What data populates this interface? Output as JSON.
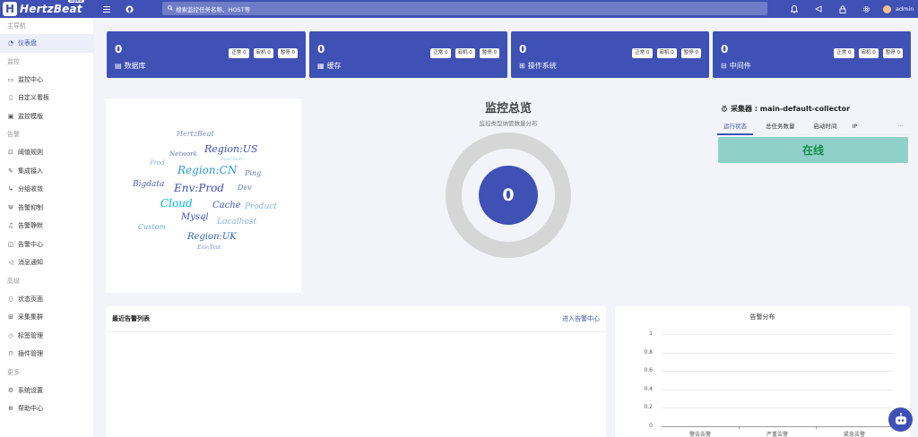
{
  "header": {
    "logo_text": "HertzBeat",
    "logo_mark": "H",
    "logo_badge": "alpha",
    "menu_icon": "menu-icon",
    "github_icon": "github-icon",
    "search_placeholder": "搜索监控任务名称、HOST等",
    "icons": [
      "bell-icon",
      "send-icon",
      "lock-icon",
      "gear-icon"
    ],
    "user_name": "admin"
  },
  "sidebar": {
    "groups": [
      {
        "label": "主导航",
        "items": [
          {
            "label": "仪表盘",
            "icon": "dashboard-icon",
            "active": true
          }
        ]
      },
      {
        "label": "监控",
        "items": [
          {
            "label": "监控中心",
            "icon": "monitor-icon"
          },
          {
            "label": "自定义看板",
            "icon": "board-icon"
          },
          {
            "label": "监控模版",
            "icon": "template-icon"
          }
        ]
      },
      {
        "label": "告警",
        "items": [
          {
            "label": "阈值规则",
            "icon": "rule-icon"
          },
          {
            "label": "集成接入",
            "icon": "integration-icon"
          },
          {
            "label": "分组收敛",
            "icon": "group-icon"
          },
          {
            "label": "告警抑制",
            "icon": "inhibit-icon"
          },
          {
            "label": "告警静默",
            "icon": "silence-icon"
          },
          {
            "label": "告警中心",
            "icon": "alert-center-icon"
          },
          {
            "label": "消息通知",
            "icon": "notify-icon"
          }
        ]
      },
      {
        "label": "高级",
        "items": [
          {
            "label": "状态页面",
            "icon": "status-page-icon"
          },
          {
            "label": "采集集群",
            "icon": "cluster-icon"
          },
          {
            "label": "标签管理",
            "icon": "tag-icon"
          },
          {
            "label": "插件管理",
            "icon": "plugin-icon"
          }
        ]
      },
      {
        "label": "更多",
        "items": [
          {
            "label": "系统设置",
            "icon": "settings-icon"
          },
          {
            "label": "帮助中心",
            "icon": "help-icon"
          }
        ]
      }
    ]
  },
  "cards": [
    {
      "count": "0",
      "label": "数据库",
      "icon": "database-icon",
      "normal": "正常 0",
      "down": "宕机 0",
      "paused": "暂停 0"
    },
    {
      "count": "0",
      "label": "缓存",
      "icon": "cache-icon",
      "normal": "正常 0",
      "down": "宕机 0",
      "paused": "暂停 0"
    },
    {
      "count": "0",
      "label": "操作系统",
      "icon": "os-icon",
      "normal": "正常 0",
      "down": "宕机 0",
      "paused": "暂停 0"
    },
    {
      "count": "0",
      "label": "中间件",
      "icon": "middleware-icon",
      "normal": "正常 0",
      "down": "宕机 0",
      "paused": "暂停 0"
    }
  ],
  "wordcloud": {
    "words": [
      "HertzBeat",
      "Network",
      "Region:US",
      "Prod",
      "ZooCloud",
      "Region:CN",
      "Ping",
      "Bigdata",
      "Env:Prod",
      "Dev",
      "Cloud",
      "Cache",
      "Product",
      "Mysql",
      "Localhost",
      "Custom",
      "Region:UK",
      "Env:Test"
    ]
  },
  "overview": {
    "title": "监控总览",
    "subtitle": "监控类型纳管数量分布",
    "total": "0"
  },
  "collector": {
    "title": "采集器 : main-default-collector",
    "icon": "bug-icon",
    "tabs": [
      "运行状态",
      "总任务数量",
      "启动时间",
      "IP"
    ],
    "more": "···",
    "status": "在线"
  },
  "alerts": {
    "title": "最近告警列表",
    "link": "进入告警中心"
  },
  "distribution": {
    "title": "告警分布"
  },
  "chart_data": {
    "type": "bar",
    "title": "告警分布",
    "categories": [
      "警告告警",
      "严重告警",
      "紧急告警"
    ],
    "values": [
      0,
      0,
      0
    ],
    "yticks": [
      "0",
      "0.2",
      "0.4",
      "0.6",
      "0.8",
      "1"
    ],
    "ylim": [
      0,
      1
    ],
    "grid": true
  },
  "chatbot_icon": "robot-icon"
}
